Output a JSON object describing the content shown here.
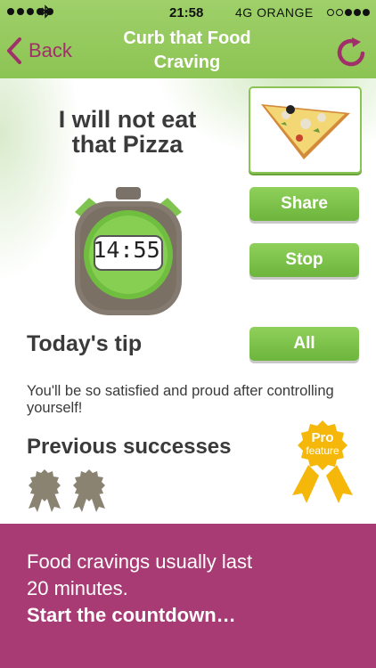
{
  "status_bar": {
    "time": "21:58",
    "network": "4G",
    "carrier": "ORANGE"
  },
  "nav": {
    "back_label": "Back",
    "title_line1": "Curb that Food",
    "title_line2": "Craving",
    "accent_color": "#a0306a",
    "header_color": "#8cc453"
  },
  "goal": {
    "line1": "I will not eat",
    "line2": "that Pizza"
  },
  "timer": {
    "display": "14:55"
  },
  "buttons": {
    "share": "Share",
    "stop": "Stop",
    "all": "All",
    "button_color": "#6db53c"
  },
  "tip": {
    "heading": "Today's tip",
    "text": "You'll be so satisfied and proud after controlling yourself!"
  },
  "previous": {
    "heading": "Previous successes",
    "medal_count": 2
  },
  "pro_badge": {
    "line1": "Pro",
    "line2": "feature",
    "color": "#f5b80a"
  },
  "footer": {
    "line1": "Food cravings usually last",
    "line2": "20 minutes.",
    "cta": "Start the countdown…",
    "color": "#a83b73"
  }
}
